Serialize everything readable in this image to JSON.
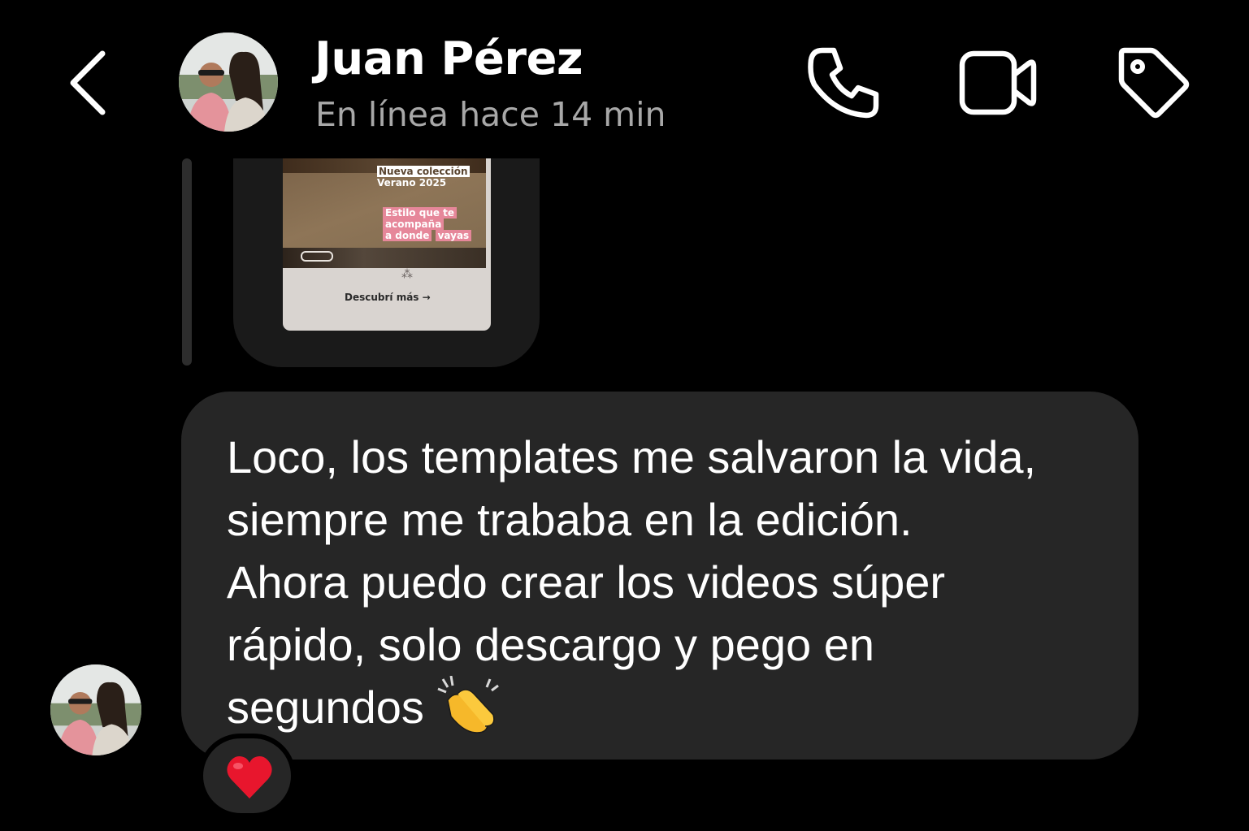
{
  "header": {
    "contact_name": "Juan Pérez",
    "status": "En línea hace 14 min",
    "back_icon": "chevron-left-icon",
    "call_icon": "phone-icon",
    "video_icon": "video-camera-icon",
    "tag_icon": "tag-icon"
  },
  "shared_post": {
    "title_line1": "Nueva colección",
    "title_line2": "Verano 2025",
    "sub_line1": "Estilo que te",
    "sub_line2": "acompaña",
    "sub_line3": "a donde",
    "sub_line4": "vayas",
    "cta": "Descubrí más →"
  },
  "message": {
    "text": "Loco, los templates me salvaron la vida,\nsiempre me trababa en la edición.\nAhora puedo crear los videos súper\nrápido, solo descargo y pego en\nsegundos",
    "emoji": "clapping-hands",
    "reaction": "heart"
  },
  "colors": {
    "background": "#000000",
    "bubble": "#262626",
    "status_text": "#a8a8a8",
    "reaction_heart": "#e8162d"
  }
}
